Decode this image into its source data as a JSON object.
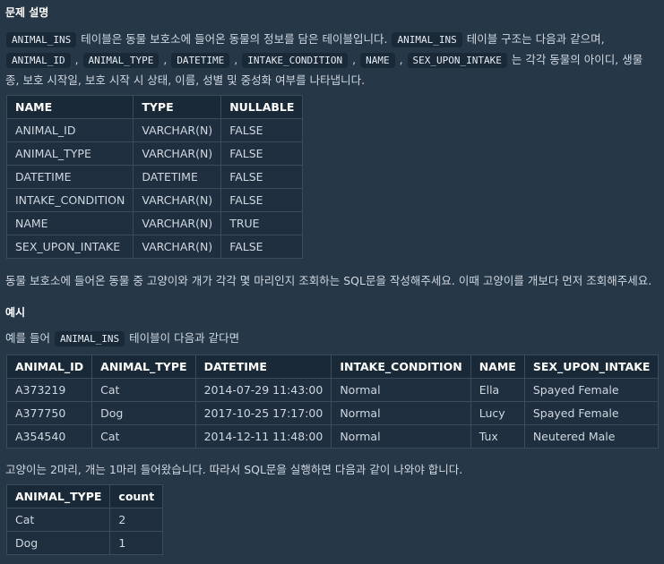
{
  "section_title": "문제 설명",
  "desc": {
    "code_animal_ins": "ANIMAL_INS",
    "t1": " 테이블은 동물 보호소에 들어온 동물의 정보를 담은 테이블입니다. ",
    "code_animal_ins2": "ANIMAL_INS",
    "t2": " 테이블 구조는 다음과 같으며, ",
    "c_animal_id": "ANIMAL_ID",
    "c_animal_type": "ANIMAL_TYPE",
    "c_datetime": "DATETIME",
    "c_intake": "INTAKE_CONDITION",
    "c_name": "NAME",
    "c_sex": "SEX_UPON_INTAKE",
    "t3": " 는 각각 동물의 아이디, 생물 종, 보호 시작일, 보호 시작 시 상태, 이름, 성별 및 중성화 여부를 나타냅니다."
  },
  "schema_table": {
    "headers": [
      "NAME",
      "TYPE",
      "NULLABLE"
    ],
    "rows": [
      [
        "ANIMAL_ID",
        "VARCHAR(N)",
        "FALSE"
      ],
      [
        "ANIMAL_TYPE",
        "VARCHAR(N)",
        "FALSE"
      ],
      [
        "DATETIME",
        "DATETIME",
        "FALSE"
      ],
      [
        "INTAKE_CONDITION",
        "VARCHAR(N)",
        "FALSE"
      ],
      [
        "NAME",
        "VARCHAR(N)",
        "TRUE"
      ],
      [
        "SEX_UPON_INTAKE",
        "VARCHAR(N)",
        "FALSE"
      ]
    ]
  },
  "task_text": "동물 보호소에 들어온 동물 중 고양이와 개가 각각 몇 마리인지 조회하는 SQL문을 작성해주세요. 이때 고양이를 개보다 먼저 조회해주세요.",
  "example_title": "예시",
  "example_intro_pre": "예를 들어 ",
  "example_intro_code": "ANIMAL_INS",
  "example_intro_post": " 테이블이 다음과 같다면",
  "example_table": {
    "headers": [
      "ANIMAL_ID",
      "ANIMAL_TYPE",
      "DATETIME",
      "INTAKE_CONDITION",
      "NAME",
      "SEX_UPON_INTAKE"
    ],
    "rows": [
      [
        "A373219",
        "Cat",
        "2014-07-29 11:43:00",
        "Normal",
        "Ella",
        "Spayed Female"
      ],
      [
        "A377750",
        "Dog",
        "2017-10-25 17:17:00",
        "Normal",
        "Lucy",
        "Spayed Female"
      ],
      [
        "A354540",
        "Cat",
        "2014-12-11 11:48:00",
        "Normal",
        "Tux",
        "Neutered Male"
      ]
    ]
  },
  "result_text": "고양이는 2마리, 개는 1마리 들어왔습니다. 따라서 SQL문을 실행하면 다음과 같이 나와야 합니다.",
  "result_table": {
    "headers": [
      "ANIMAL_TYPE",
      "count"
    ],
    "rows": [
      [
        "Cat",
        "2"
      ],
      [
        "Dog",
        "1"
      ]
    ]
  }
}
